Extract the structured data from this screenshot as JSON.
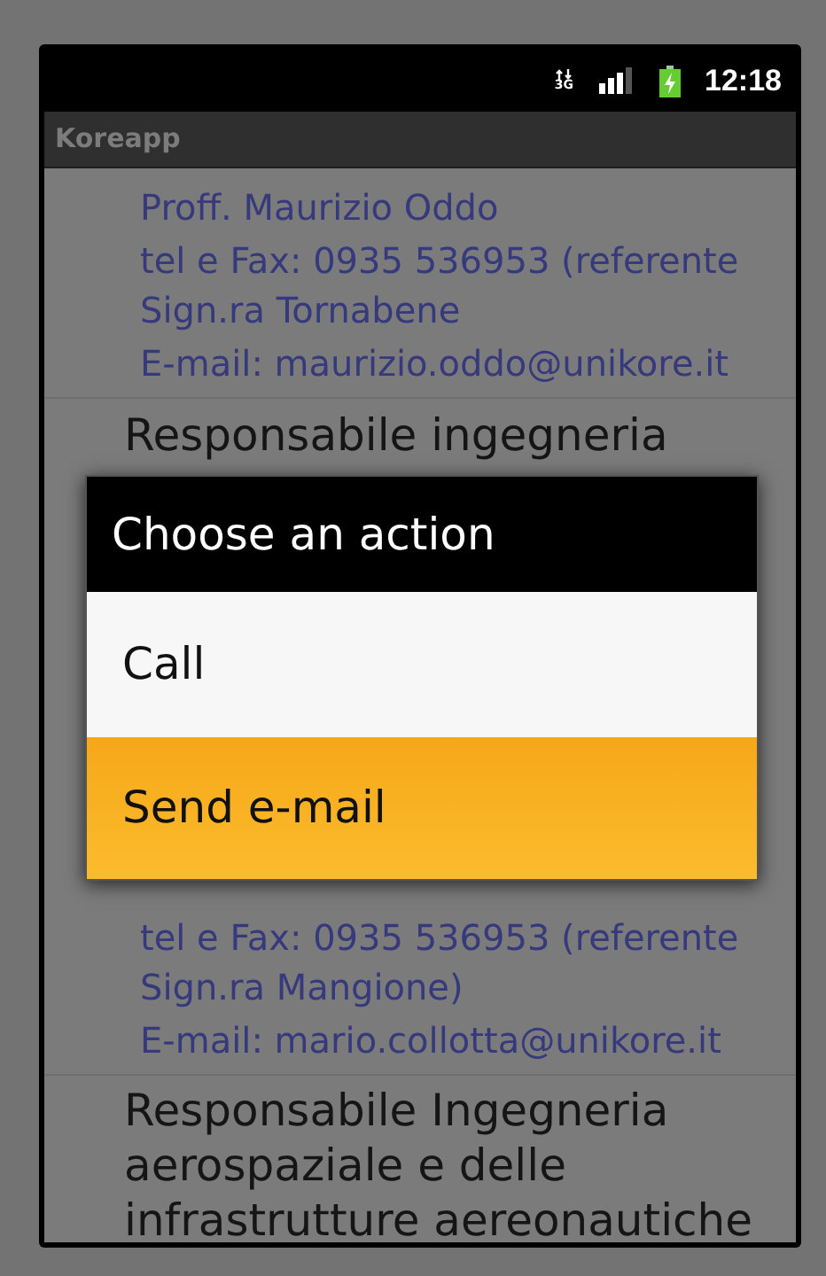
{
  "status_bar": {
    "network": "3G",
    "time": "12:18"
  },
  "app_title": "Koreapp",
  "list": [
    {
      "kind": "details",
      "lines": [
        "Proff. Maurizio Oddo",
        "tel e Fax: 0935 536953 (referente Sign.ra Tornabene",
        "E-mail: maurizio.oddo@unikore.it"
      ]
    },
    {
      "kind": "heading",
      "text": "Responsabile ingegneria"
    },
    {
      "kind": "details",
      "lines": [
        "tel e Fax: 0935 536953 (referente Sign.ra Mangione)",
        "E-mail: mario.collotta@unikore.it"
      ]
    },
    {
      "kind": "heading",
      "text": "Responsabile Ingegneria aerospaziale e delle infrastrutture aereonautiche"
    }
  ],
  "dialog": {
    "title": "Choose an action",
    "items": [
      {
        "label": "Call",
        "selected": false
      },
      {
        "label": "Send e-mail",
        "selected": true
      }
    ]
  }
}
